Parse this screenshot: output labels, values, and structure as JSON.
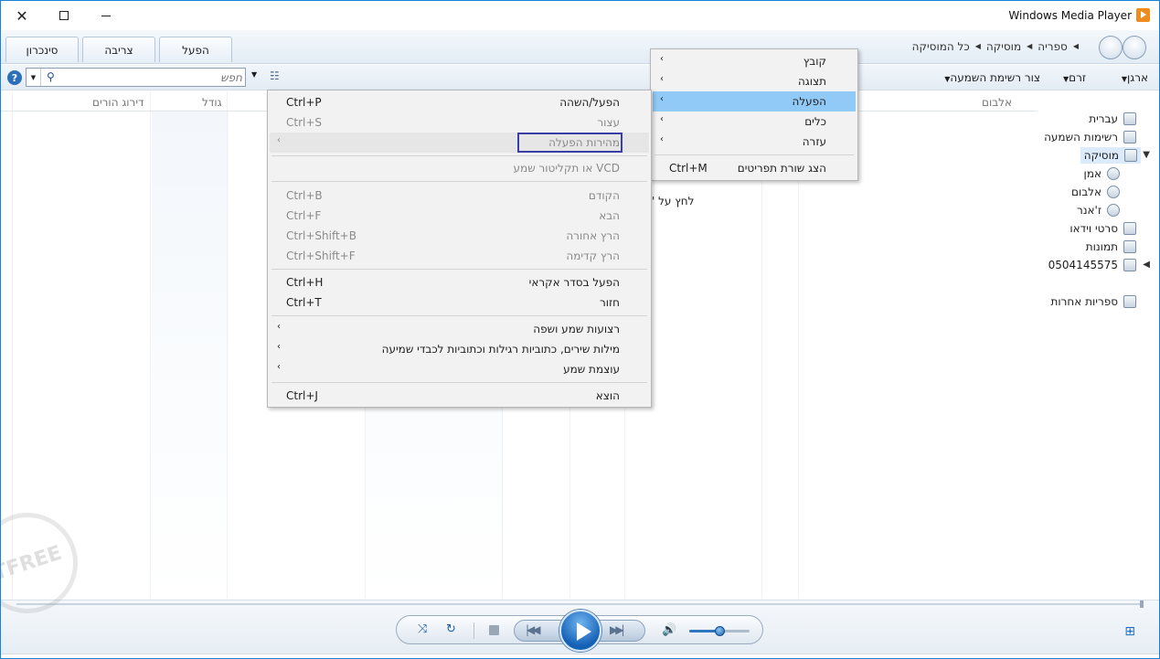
{
  "window": {
    "app_title": "Windows Media Player",
    "close_glyph": "✕"
  },
  "tabs": [
    {
      "label": "סינכרון"
    },
    {
      "label": "צריבה"
    },
    {
      "label": "הפעל"
    }
  ],
  "breadcrumb": [
    "ספריה",
    "מוסיקה",
    "כל המוסיקה"
  ],
  "toolbar": {
    "search_placeholder": "חפש",
    "organize": "ארגן",
    "stream": "זרם",
    "create_playlist": "צור רשימת השמעה"
  },
  "columns": {
    "album": "אלבום",
    "size": "גודל",
    "parental_rating": "דירוג הורים"
  },
  "nav_pane": {
    "user": "עברית",
    "playlists": "רשימות השמעה",
    "music": "מוסיקה",
    "artist": "אמן",
    "album": "אלבום",
    "genre": "ז'אנר",
    "videos": "סרטי וידאו",
    "pictures": "תמונות",
    "device": "0504145575",
    "other_libraries": "ספריות אחרות"
  },
  "hint_text": "לחץ על '",
  "main_menu": {
    "items": [
      {
        "label": "קובץ"
      },
      {
        "label": "תצוגה"
      },
      {
        "label": "הפעלה"
      },
      {
        "label": "כלים"
      },
      {
        "label": "עזרה"
      }
    ],
    "show_menu_bar": {
      "label": "הצג שורת תפריטים",
      "shortcut": "Ctrl+M"
    }
  },
  "play_menu": {
    "play_pause": {
      "label": "הפעל/השהה",
      "shortcut": "Ctrl+P"
    },
    "stop": {
      "label": "עצור",
      "shortcut": "Ctrl+S"
    },
    "play_speed": {
      "label": "מהירות הפעלה"
    },
    "dvd": {
      "label": "VCD או תקליטור שמע"
    },
    "previous": {
      "label": "הקודם",
      "shortcut": "Ctrl+B"
    },
    "next": {
      "label": "הבא",
      "shortcut": "Ctrl+F"
    },
    "rewind": {
      "label": "הרץ אחורה",
      "shortcut": "Ctrl+Shift+B"
    },
    "fast_forward": {
      "label": "הרץ קדימה",
      "shortcut": "Ctrl+Shift+F"
    },
    "shuffle": {
      "label": "הפעל בסדר אקראי",
      "shortcut": "Ctrl+H"
    },
    "repeat": {
      "label": "חזור",
      "shortcut": "Ctrl+T"
    },
    "audio_language": {
      "label": "רצועות שמע ושפה"
    },
    "lyrics": {
      "label": "מילות שירים, כתוביות רגילות וכתוביות לכבדי שמיעה"
    },
    "volume": {
      "label": "עוצמת שמע"
    },
    "eject": {
      "label": "הוצא",
      "shortcut": "Ctrl+J"
    }
  },
  "transport": {
    "volume_level": 0.5
  },
  "watermark_text": "TFREE",
  "colors": {
    "menu_highlight": "#91c9f7",
    "accent": "#1683d8",
    "focus_box": "#3a3fa8"
  }
}
